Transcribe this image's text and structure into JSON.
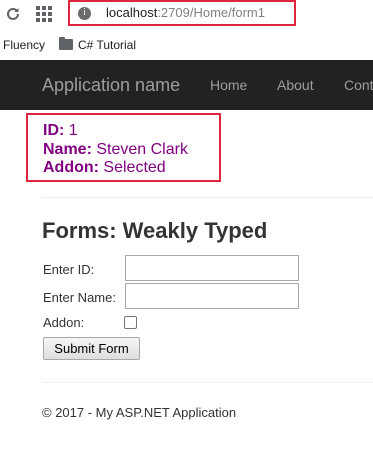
{
  "browser": {
    "url_host": "localhost",
    "url_path": ":2709/Home/form1",
    "site_icon_glyph": "i",
    "bookmarks": [
      "Fluency",
      "C# Tutorial"
    ]
  },
  "navbar": {
    "brand": "Application name",
    "links": [
      "Home",
      "About",
      "Cont"
    ]
  },
  "result": {
    "id_label": "ID:",
    "id_value": " 1",
    "name_label": "Name:",
    "name_value": " Steven Clark",
    "addon_label": "Addon:",
    "addon_value": " Selected"
  },
  "form": {
    "title": "Forms: Weakly Typed",
    "id_label": "Enter ID:",
    "id_value": "",
    "name_label": "Enter Name:",
    "name_value": "",
    "addon_label": "Addon:",
    "addon_checked": false,
    "submit_label": "Submit Form"
  },
  "footer": {
    "text": "© 2017 - My ASP.NET Application"
  },
  "colors": {
    "highlight_border": "#e0263f",
    "result_text": "#800080",
    "navbar_bg": "#222222",
    "navbar_text": "#9d9d9d"
  }
}
